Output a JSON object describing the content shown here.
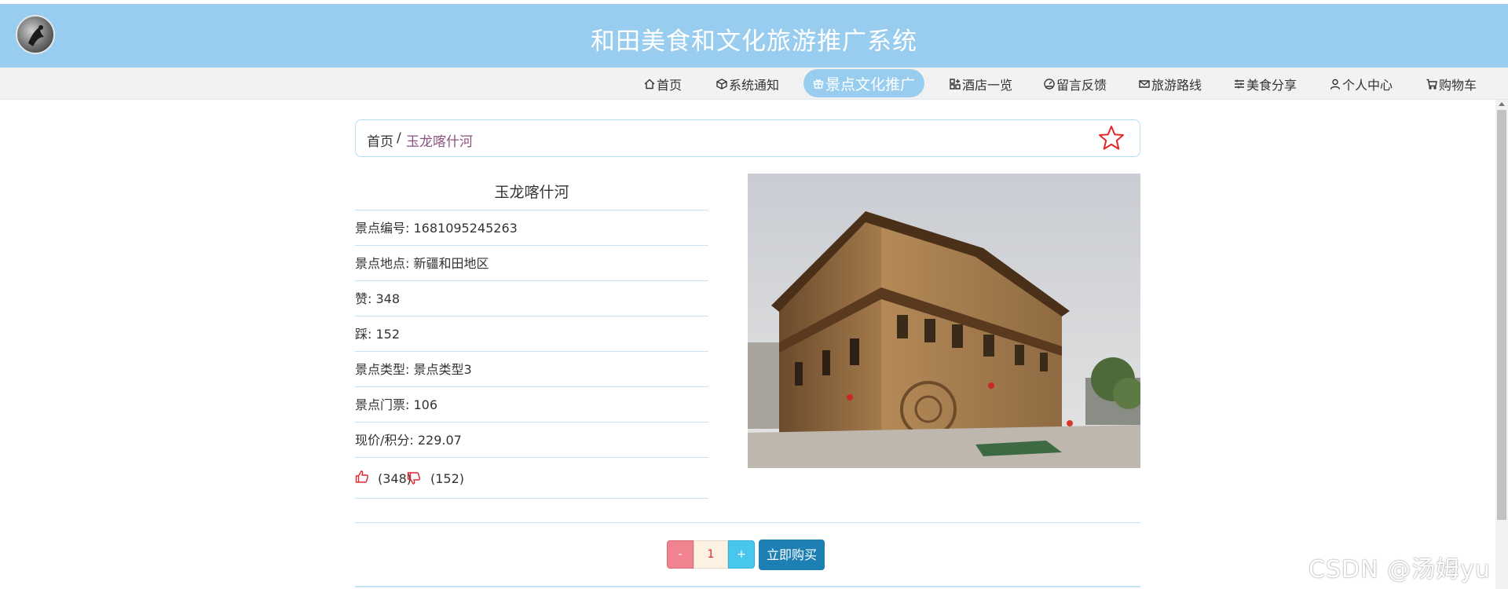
{
  "header": {
    "title": "和田美食和文化旅游推广系统"
  },
  "nav": {
    "items": [
      {
        "label": "首页",
        "icon": "home-icon"
      },
      {
        "label": "系统通知",
        "icon": "cube-icon"
      },
      {
        "label": "景点文化推广",
        "icon": "gift-icon"
      },
      {
        "label": "酒店一览",
        "icon": "grid-icon"
      },
      {
        "label": "留言反馈",
        "icon": "dashboard-icon"
      },
      {
        "label": "旅游路线",
        "icon": "mail-icon"
      },
      {
        "label": "美食分享",
        "icon": "sliders-icon"
      },
      {
        "label": "个人中心",
        "icon": "user-icon"
      },
      {
        "label": "购物车",
        "icon": "cart-icon"
      }
    ],
    "active_index": 2
  },
  "breadcrumb": {
    "home": "首页",
    "separator": "/",
    "current": "玉龙喀什河"
  },
  "detail": {
    "title": "玉龙喀什河",
    "rows": [
      "景点编号: 1681095245263",
      "景点地点: 新疆和田地区",
      "赞: 348",
      "踩: 152",
      "景点类型: 景点类型3",
      "景点门票: 106",
      "现价/积分: 229.07"
    ],
    "likes": "(348)",
    "dislikes": "(152)"
  },
  "purchase": {
    "minus": "-",
    "quantity": "1",
    "plus": "+",
    "buy_label": "立即购买"
  },
  "watermark": "CSDN @汤姆yu",
  "colors": {
    "header_bg": "#99cdef",
    "nav_bg": "#f2f2f2",
    "accent_red": "#e2262a",
    "buy_button": "#1e7fb3",
    "minus_button": "#f0838f",
    "plus_button": "#47c7ee"
  }
}
